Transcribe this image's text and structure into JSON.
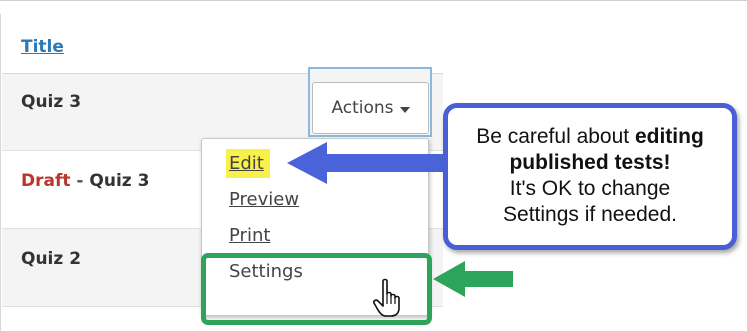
{
  "table": {
    "header": {
      "title": "Title"
    },
    "rows": [
      {
        "name": "Quiz 3"
      },
      {
        "draft_label": "Draft",
        "separator": " - ",
        "name": "Quiz 3"
      },
      {
        "name": "Quiz 2"
      }
    ]
  },
  "actions": {
    "label": "Actions"
  },
  "menu": {
    "items": [
      {
        "label": "Edit",
        "highlighted": true
      },
      {
        "label": "Preview"
      },
      {
        "label": "Print"
      },
      {
        "label": "Settings",
        "hovered": true
      }
    ]
  },
  "callout": {
    "line1_prefix": "Be careful about ",
    "line1_bold": "editing",
    "line2_bold": "published tests",
    "line2_suffix": "!",
    "line3": "It's OK to change",
    "line4": "Settings if needed."
  },
  "colors": {
    "link": "#2a79b8",
    "draft": "#b8362a",
    "highlight": "#f8f14a",
    "callout_border": "#4a5fd6",
    "green_annotation": "#2ea35a"
  },
  "icons": [
    "caret-down-icon",
    "pointer-hand-cursor-icon",
    "blue-arrow-icon",
    "green-arrow-icon"
  ]
}
